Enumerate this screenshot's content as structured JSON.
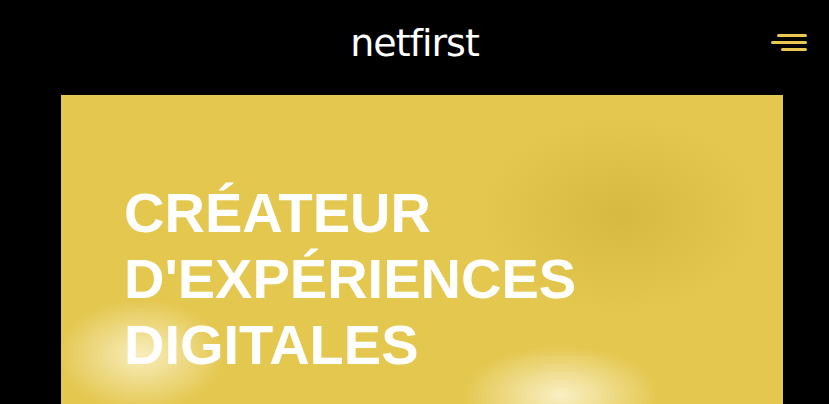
{
  "header": {
    "logo": "netfirst"
  },
  "hero": {
    "title_lines": [
      "CRÉATEUR",
      "D'EXPÉRIENCES",
      "DIGITALES"
    ]
  }
}
